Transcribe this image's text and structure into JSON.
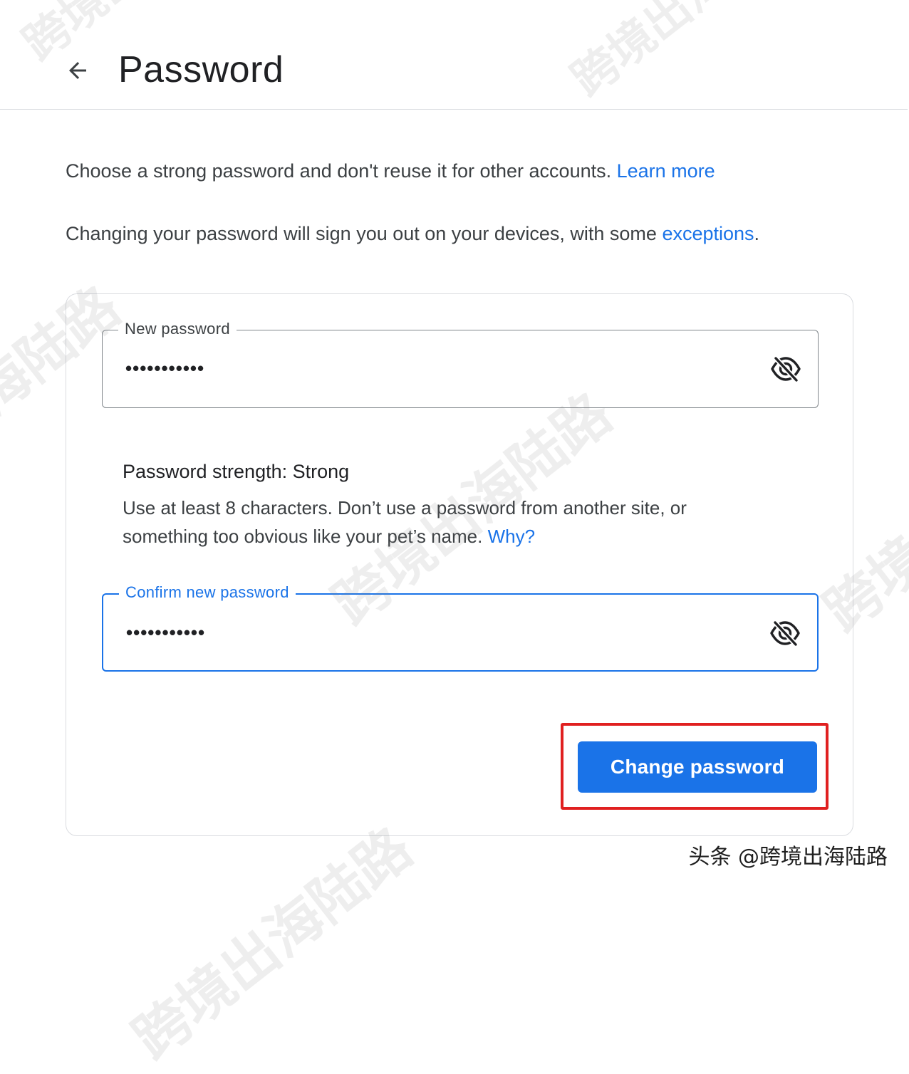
{
  "header": {
    "back_icon": "arrow-left-icon",
    "title": "Password"
  },
  "intro": {
    "line1_text": "Choose a strong password and don't reuse it for other accounts.",
    "line1_link": "Learn more",
    "line2_text": "Changing your password will sign you out on your devices, with some",
    "line2_link": "exceptions",
    "line2_end": "."
  },
  "form": {
    "new_password": {
      "label": "New password",
      "value": "•••••••••••",
      "toggle_icon": "eye-off-icon"
    },
    "strength": {
      "title": "Password strength: Strong",
      "description": "Use at least 8 characters. Don’t use a password from another site, or something too obvious like your pet’s name.",
      "link": "Why?"
    },
    "confirm_password": {
      "label": "Confirm new password",
      "value": "•••••••••••",
      "toggle_icon": "eye-off-icon",
      "focused": true
    },
    "submit_label": "Change password"
  },
  "watermark": {
    "text": "跨境出海陆路",
    "credit": "头条 @跨境出海陆路"
  },
  "colors": {
    "accent": "#1a73e8",
    "highlight": "#e02020",
    "text": "#202124",
    "border": "#dadce0"
  }
}
